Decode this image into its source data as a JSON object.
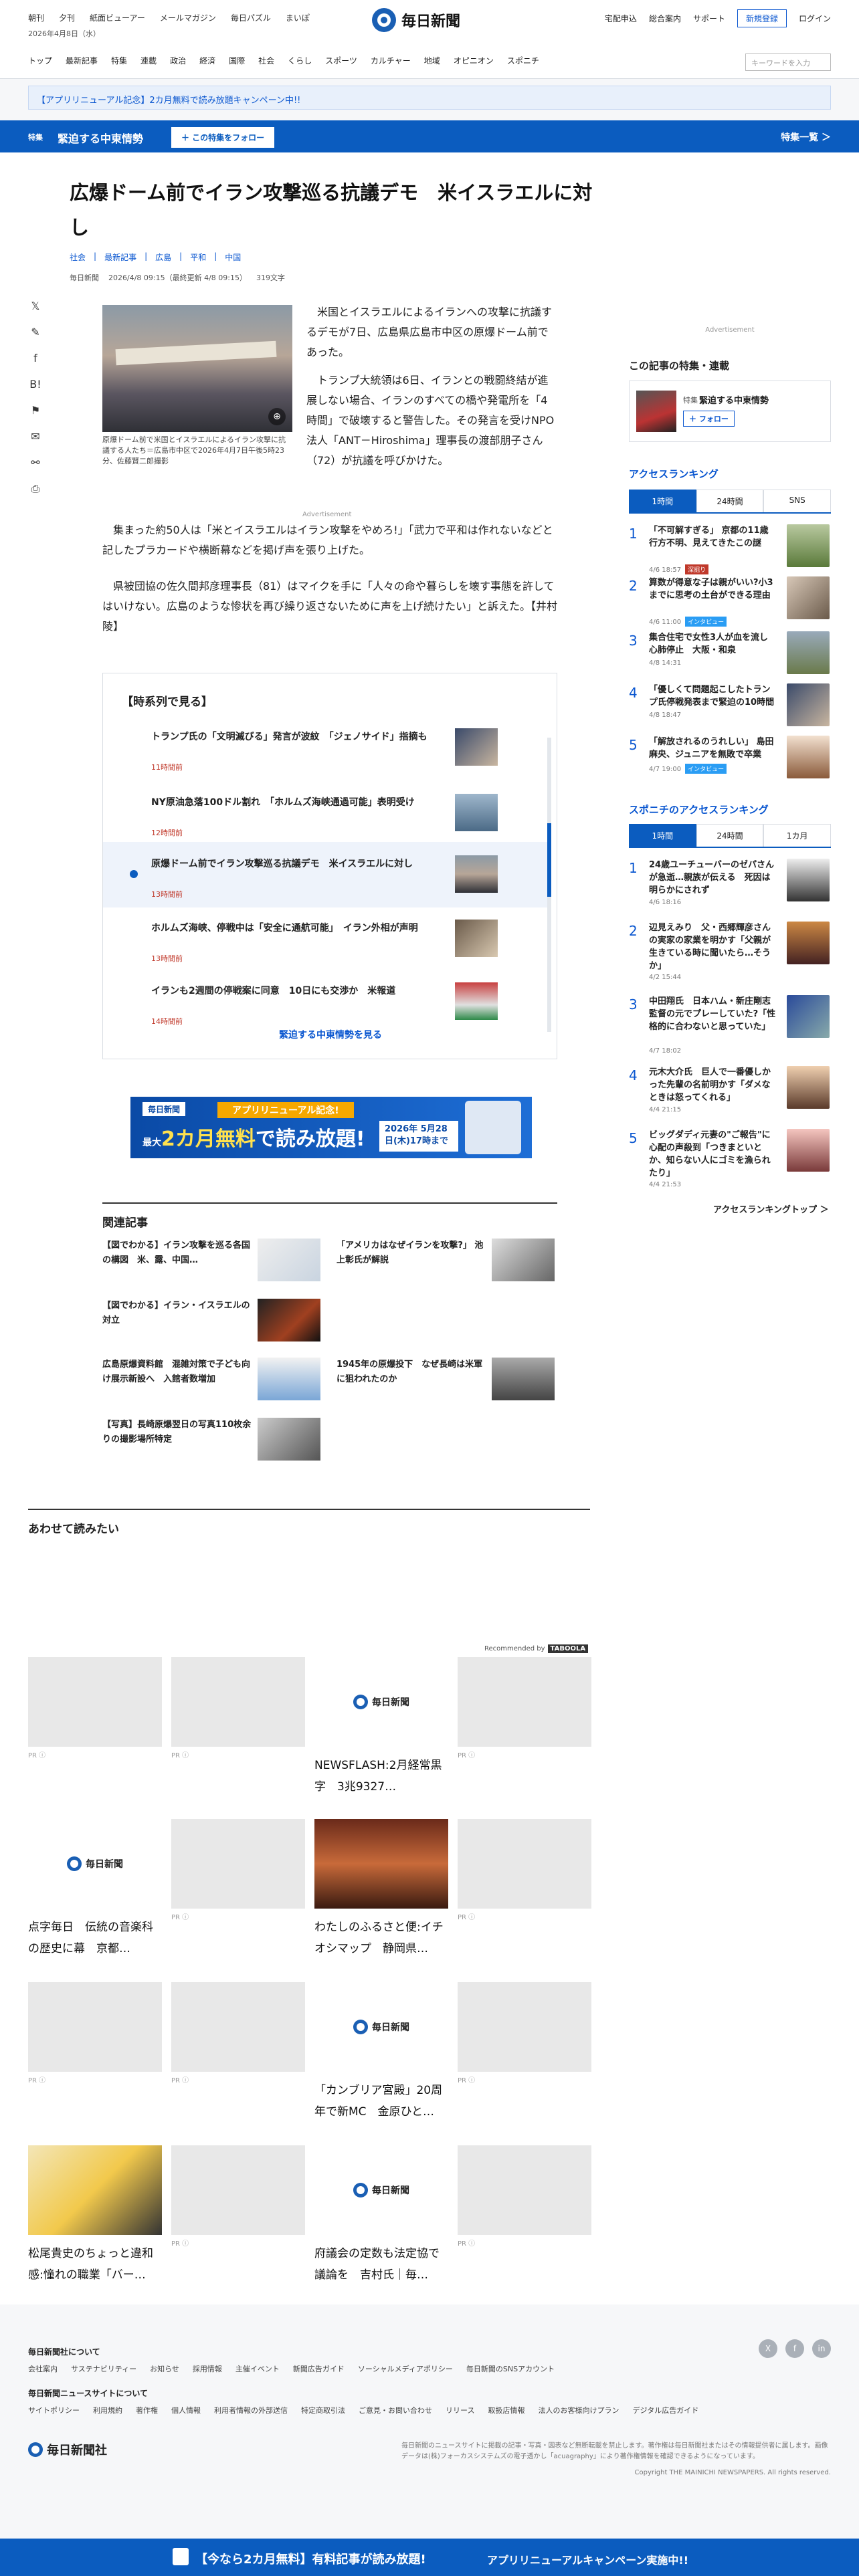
{
  "header": {
    "top_links": [
      "朝刊",
      "夕刊",
      "紙面ビューアー",
      "メールマガジン",
      "毎日パズル",
      "まいぽ"
    ],
    "date": "2026年4月8日（水）",
    "logo": "毎日新聞",
    "right_links": [
      "宅配申込",
      "総合案内",
      "サポート"
    ],
    "register": "新規登録",
    "login": "ログイン",
    "nav": [
      "トップ",
      "最新記事",
      "特集",
      "連載",
      "政治",
      "経済",
      "国際",
      "社会",
      "くらし",
      "スポーツ",
      "カルチャー",
      "地域",
      "オピニオン",
      "スポニチ"
    ],
    "search_placeholder": "キーワードを入力"
  },
  "campaign_bar": "【アプリリニューアル記念】2カ月無料で読み放題キャンペーン中!!",
  "feature_bar": {
    "tag": "特集",
    "title": "緊迫する中東情勢",
    "follow": "＋ この特集をフォロー",
    "list": "特集一覧 ＞"
  },
  "article": {
    "title": "広爆ドーム前でイラン攻撃巡る抗議デモ　米イスラエルに対し",
    "categories": [
      "社会",
      "最新記事",
      "広島",
      "平和",
      "中国"
    ],
    "source": "毎日新聞",
    "date": "2026/4/8 09:15（最終更新 4/8 09:15）",
    "chars": "319文字",
    "caption": "原爆ドーム前で米国とイスラエルによるイラン攻撃に抗議する人たち＝広島市中区で2026年4月7日午後5時23分、佐藤賢二郎撮影",
    "para1": "　米国とイスラエルによるイランへの攻撃に抗議するデモが7日、広島県広島市中区の原爆ドーム前であった。",
    "para2": "　トランプ大統領は6日、イランとの戦闘終結が進展しない場合、イランのすべての橋や発電所を「4時間」で破壊すると警告した。その発言を受けNPO法人「ANT－Hiroshima」理事長の渡部朋子さん（72）が抗議を呼びかけた。",
    "advert": "Advertisement",
    "para3": "　集まった約50人は「米とイスラエルはイラン攻撃をやめろ!」「武力で平和は作れないなどと記したプラカードや横断幕などを掲げ声を張り上げた。",
    "para4": "　県被団協の佐久間邦彦理事長（81）はマイクを手に「人々の命や暮らしを壊す事態を許してはいけない。広島のような惨状を再び繰り返さないために声を上げ続けたい」と訴えた。【井村陵】"
  },
  "timeline": {
    "heading": "【時系列で見る】",
    "items": [
      {
        "title": "トランプ氏の「文明滅びる」発言が波紋　「ジェノサイド」指摘も",
        "date": "11時間前"
      },
      {
        "title": "NY原油急落100ドル割れ　「ホルムズ海峡通過可能」表明受け",
        "date": "12時間前"
      },
      {
        "title": "原爆ドーム前でイラン攻撃巡る抗議デモ　米イスラエルに対し",
        "date": "13時間前"
      },
      {
        "title": "ホルムズ海峡、停戦中は「安全に通航可能」　イラン外相が声明",
        "date": "13時間前"
      },
      {
        "title": "イランも2週間の停戦案に同意　10日にも交渉か　米報道",
        "date": "14時間前"
      }
    ],
    "more": "緊迫する中東情勢を見る"
  },
  "promo": {
    "brand": "毎日新聞",
    "tag": "アプリリニューアル記念!",
    "headline_a": "最大",
    "headline_b": "2カ月無料",
    "headline_c": "で読み放題!",
    "date": "2026年 5月28日(木)17時まで"
  },
  "related": {
    "heading": "関連記事",
    "items": [
      "【図でわかる】イラン攻撃を巡る各国の構図　米、露、中国…",
      "「アメリカはなぜイランを攻撃?」 池上彰氏が解説",
      "【図でわかる】イラン・イスラエルの対立",
      "広島原爆資料館　混雑対策で子ども向け展示新設へ　入館者数増加",
      "1945年の原爆投下　なぜ長崎は米軍に狙われたのか",
      "【写真】長崎原爆翌日の写真110枚余りの撮影場所特定"
    ]
  },
  "together": {
    "heading": "あわせて読みたい",
    "recommended": "Recommended by",
    "recommended_brand": "TABOOLA",
    "cards": [
      {
        "title": "",
        "pr": "PR"
      },
      {
        "title": "",
        "pr": "PR"
      },
      {
        "title": "NEWSFLASH:2月経常黒字　3兆9327…",
        "pr": ""
      },
      {
        "title": "",
        "pr": "PR"
      },
      {
        "title": "点字毎日　伝統の音楽科の歴史に幕　京都…",
        "pr": ""
      },
      {
        "title": "",
        "pr": "PR"
      },
      {
        "title": "わたしのふるさと便:イチオシマップ　静岡県…",
        "pr": ""
      },
      {
        "title": "",
        "pr": "PR"
      },
      {
        "title": "",
        "pr": "PR"
      },
      {
        "title": "",
        "pr": "PR"
      },
      {
        "title": "「カンブリア宮殿」20周年で新MC　金原ひと…",
        "pr": ""
      },
      {
        "title": "",
        "pr": "PR"
      },
      {
        "title": "松尾貴史のちょっと違和感:憧れの職業「バー…",
        "pr": ""
      },
      {
        "title": "",
        "pr": "PR"
      },
      {
        "title": "府議会の定数も法定協で議論を　吉村氏｜毎…",
        "pr": ""
      },
      {
        "title": "",
        "pr": "PR"
      }
    ]
  },
  "sidebar": {
    "advert": "Advertisement",
    "feature_heading": "この記事の特集・連載",
    "feature_tag": "特集",
    "feature_name": "緊迫する中東情勢",
    "feature_follow": "＋ フォロー",
    "access_heading": "アクセスランキング",
    "access_tabs": [
      "1時間",
      "24時間",
      "SNS"
    ],
    "access": [
      {
        "title": "「不可解すぎる」 京都の11歳行方不明、見えてきたこの謎",
        "date": "4/6 18:57",
        "badge": "深掘り"
      },
      {
        "title": "算数が得意な子は親がいい?小3までに思考の土台ができる理由",
        "date": "4/6 11:00",
        "badge": "インタビュー"
      },
      {
        "title": "集合住宅で女性3人が血を流し心肺停止　大阪・和泉",
        "date": "4/8 14:31",
        "badge": ""
      },
      {
        "title": "「優しくて問題起こしたトランプ氏停戦発表まで緊迫の10時間",
        "date": "4/8 18:47",
        "badge": ""
      },
      {
        "title": "「解放されるのうれしい」 島田麻央、ジュニアを無敗で卒業",
        "date": "4/7 19:00",
        "badge": "インタビュー"
      }
    ],
    "sponichi_heading": "スポニチのアクセスランキング",
    "sponichi_tabs": [
      "1時間",
      "24時間",
      "1カ月"
    ],
    "sponichi": [
      {
        "title": "24歳ユーチューバーのゼパさんが急逝…親族が伝える　死因は明らかにされず",
        "date": "4/6 18:16"
      },
      {
        "title": "辺見えみり　父・西郷輝彦さんの実家の家業を明かす「父親が生きている時に聞いたら…そうか」",
        "date": "4/2 15:44"
      },
      {
        "title": "中田翔氏　日本ハム・新庄剛志監督の元でプレーしていた?「性格的に合わないと思っていた」",
        "date": "4/7 18:02"
      },
      {
        "title": "元木大介氏　巨人で一番優しかった先輩の名前明かす「ダメなときは怒ってくれる」",
        "date": "4/4 21:15"
      },
      {
        "title": "ビッグダディ元妻の\"ご報告\"に心配の声殺到「つきまといとか、知らない人にゴミを漁られたり」",
        "date": "4/4 21:53"
      }
    ],
    "sponichi_more": "アクセスランキングトップ ＞"
  },
  "footer": {
    "about_heading": "毎日新聞社について",
    "about_links": [
      "会社案内",
      "サステナビリティー",
      "お知らせ",
      "採用情報",
      "主催イベント",
      "新聞広告ガイド",
      "ソーシャルメディアポリシー",
      "毎日新聞のSNSアカウント"
    ],
    "site_heading": "毎日新聞ニュースサイトについて",
    "site_links": [
      "サイトポリシー",
      "利用規約",
      "著作権",
      "個人情報",
      "利用者情報の外部送信",
      "特定商取引法",
      "ご意見・お問い合わせ",
      "リリース",
      "取扱店情報",
      "法人のお客様向けプラン",
      "デジタル広告ガイド"
    ],
    "social": [
      "X",
      "f",
      "in"
    ],
    "logo": "毎日新聞社",
    "note": "毎日新聞のニュースサイトに掲載の記事・写真・図表など無断転載を禁止します。著作権は毎日新聞社またはその情報提供者に属します。画像データは(株)フォーカスシステムズの電子透かし「acuagraphy」により著作権情報を確認できるようになっています。",
    "copyright": "Copyright THE MAINICHI NEWSPAPERS. All rights reserved."
  },
  "bottom_bar": {
    "message": "【今なら2カ月無料】有料記事が読み放題!",
    "cta": "アプリリニューアルキャンペーン実施中!!"
  },
  "colors": {
    "brand_blue": "#0b5cbf",
    "accent_orange": "#f6a800"
  }
}
